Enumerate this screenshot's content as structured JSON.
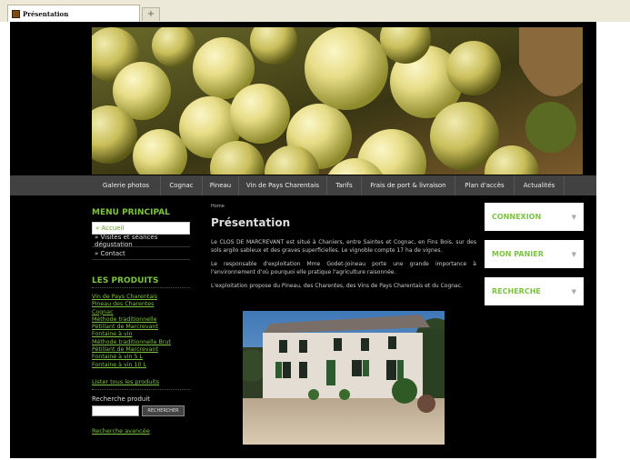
{
  "browser": {
    "tab_title": "Présentation",
    "new_tab_glyph": "+"
  },
  "nav": {
    "items": [
      {
        "label": "Galerie photos",
        "width": 76
      },
      {
        "label": "Cognac",
        "width": 46
      },
      {
        "label": "Pineau",
        "width": 40
      },
      {
        "label": "Vin de Pays Charentais",
        "width": 97
      },
      {
        "label": "Tarifs",
        "width": 38
      },
      {
        "label": "Frais de port & livraison",
        "width": 103
      },
      {
        "label": "Plan d'accès",
        "width": 65
      },
      {
        "label": "Actualités",
        "width": 55
      }
    ]
  },
  "menu": {
    "title": "MENU PRINCIPAL",
    "items": [
      "» Accueil",
      "» Visites et séances dégustation",
      "» Contact"
    ]
  },
  "products": {
    "title": "LES PRODUITS",
    "items": [
      "Vin de Pays Charentais",
      "Pineau des Charentes",
      "Cognac",
      "Méthode traditionnelle",
      "Pétillant de Marcrevant",
      "Fontaine à vin",
      "Méthode traditionnelle Brut",
      "Pétillant de Marcrevant",
      "Fontaine à vin 5 L",
      "Fontaine à vin 10 L"
    ],
    "all_link": "Lister tous les produits"
  },
  "search": {
    "label": "Recherche produit",
    "button": "RECHERCHER",
    "advanced": "Recherche avancée"
  },
  "content": {
    "breadcrumb": "Home",
    "title": "Présentation",
    "paragraphs": [
      "Le CLOS DE MARCREVANT est situé à Chaniers, entre Saintes et Cognac, en Fins Bois, sur des sols argilo sableux et des graves superficielles. Le vignoble compte 17 ha de vignes.",
      "Le responsable d'exploitation Mme Godet-Joineau porte une grande importance à l'environnement d'où pourquoi elle pratique l'agriculture raisonnée.",
      "L'exploitation propose du Pineau, des Charentes, des Vins de Pays Charentais et du Cognac."
    ]
  },
  "boxes": [
    {
      "title": "CONNEXION",
      "arrow": "▼"
    },
    {
      "title": "MON PANIER",
      "arrow": "▼"
    },
    {
      "title": "RECHERCHE",
      "arrow": "▼"
    }
  ],
  "colors": {
    "accent": "#7ec243",
    "background": "#000000",
    "navbar": "#414141"
  }
}
